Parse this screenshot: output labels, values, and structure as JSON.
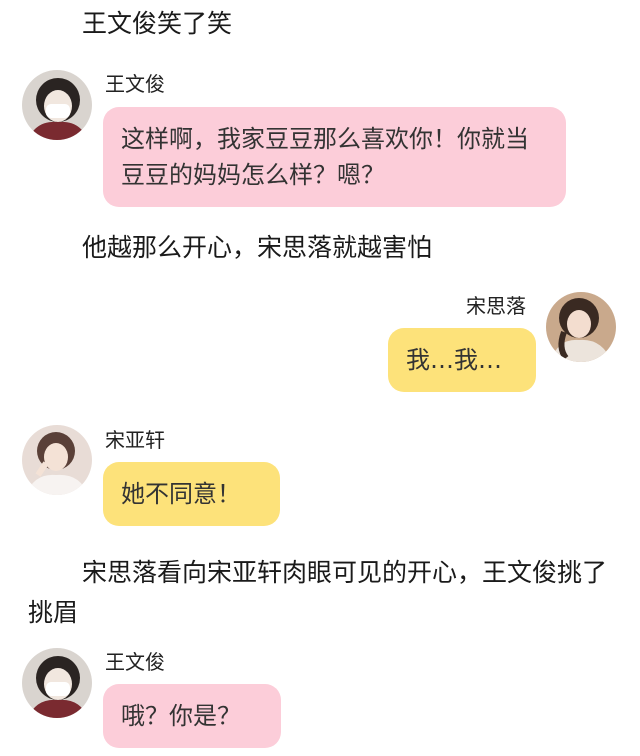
{
  "messages": [
    {
      "type": "narration",
      "text": "王文俊笑了笑"
    },
    {
      "type": "chat",
      "side": "left",
      "name": "王文俊",
      "bubble_color": "#fccdd9",
      "avatar": "wang-wenjun-avatar",
      "text": "这样啊，我家豆豆那么喜欢你！你就当豆豆的妈妈怎么样？嗯？"
    },
    {
      "type": "narration",
      "text": "他越那么开心，宋思落就越害怕"
    },
    {
      "type": "chat",
      "side": "right",
      "name": "宋思落",
      "bubble_color": "#fde27a",
      "avatar": "song-siluo-avatar",
      "text": "我…我…"
    },
    {
      "type": "chat",
      "side": "left",
      "name": "宋亚轩",
      "bubble_color": "#fde27a",
      "avatar": "song-yaxuan-avatar",
      "text": "她不同意！"
    },
    {
      "type": "narration",
      "text": "宋思落看向宋亚轩肉眼可见的开心，王文俊挑了挑眉"
    },
    {
      "type": "chat",
      "side": "left",
      "name": "王文俊",
      "bubble_color": "#fccdd9",
      "avatar": "wang-wenjun-avatar",
      "text": "哦？你是？"
    }
  ]
}
